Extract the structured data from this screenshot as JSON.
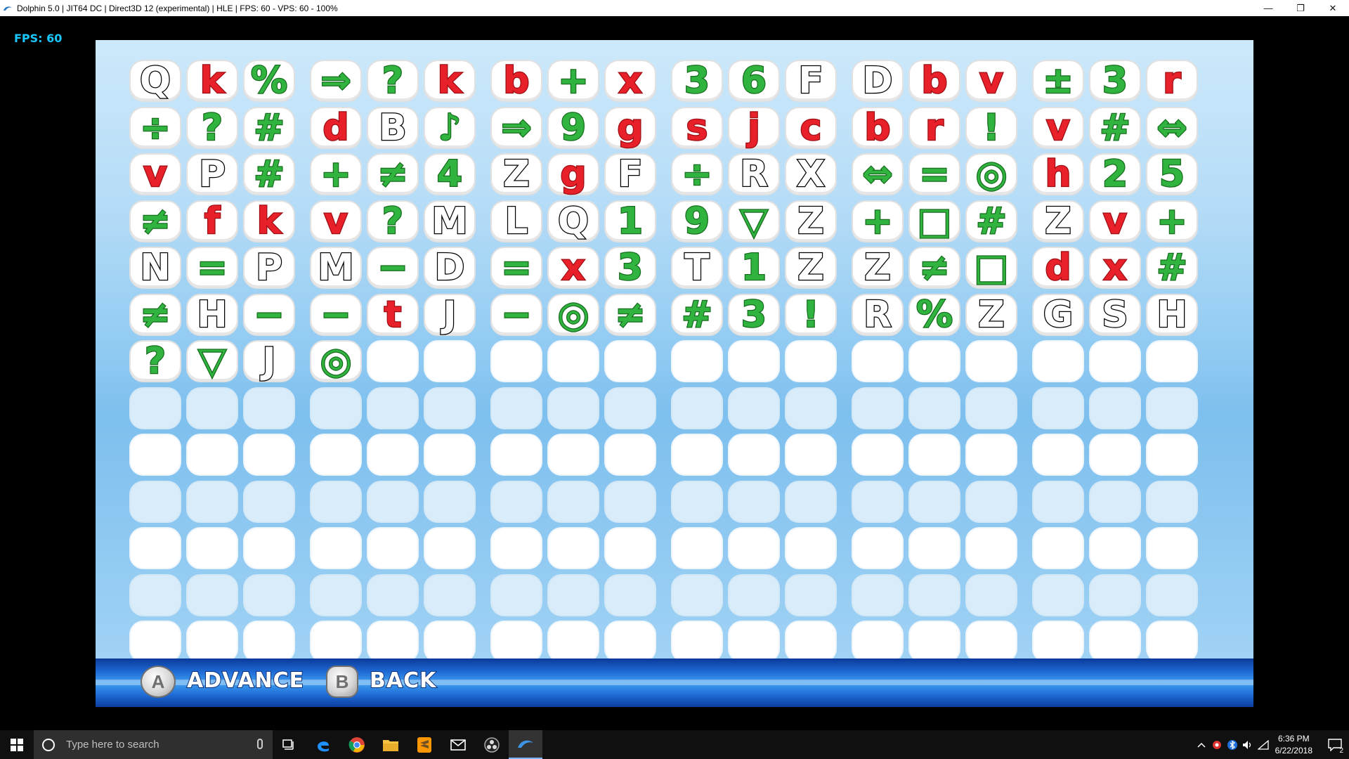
{
  "window": {
    "title": "Dolphin 5.0 | JIT64 DC | Direct3D 12 (experimental) | HLE | FPS: 60 - VPS: 60 - 100%",
    "app_icon": "dolphin-icon",
    "controls": {
      "minimize": "—",
      "restore": "❐",
      "close": "✕"
    }
  },
  "overlay": {
    "fps": "FPS: 60"
  },
  "game": {
    "colors": {
      "black": "#000000",
      "red": "#e8202a",
      "green": "#31b43f"
    },
    "grid_rows": [
      [
        [
          "Q",
          "k"
        ],
        [
          "k",
          "r"
        ],
        [
          "%",
          "g"
        ],
        [
          "⇒",
          "g"
        ],
        [
          "?",
          "g"
        ],
        [
          "k",
          "r"
        ],
        [
          "b",
          "r"
        ],
        [
          "+",
          "g"
        ],
        [
          "x",
          "r"
        ],
        [
          "3",
          "g"
        ],
        [
          "6",
          "g"
        ],
        [
          "F",
          "k"
        ],
        [
          "D",
          "k"
        ],
        [
          "b",
          "r"
        ],
        [
          "v",
          "r"
        ],
        [
          "±",
          "g"
        ],
        [
          "3",
          "g"
        ],
        [
          "r",
          "r"
        ]
      ],
      [
        [
          "÷",
          "g"
        ],
        [
          "?",
          "g"
        ],
        [
          "#",
          "g"
        ],
        [
          "d",
          "r"
        ],
        [
          "B",
          "k"
        ],
        [
          "♪",
          "g"
        ],
        [
          "⇒",
          "g"
        ],
        [
          "9",
          "g"
        ],
        [
          "g",
          "r"
        ],
        [
          "s",
          "r"
        ],
        [
          "j",
          "r"
        ],
        [
          "c",
          "r"
        ],
        [
          "b",
          "r"
        ],
        [
          "r",
          "r"
        ],
        [
          "!",
          "g"
        ],
        [
          "v",
          "r"
        ],
        [
          "#",
          "g"
        ],
        [
          "⇔",
          "g"
        ]
      ],
      [
        [
          "v",
          "r"
        ],
        [
          "P",
          "k"
        ],
        [
          "#",
          "g"
        ],
        [
          "+",
          "g"
        ],
        [
          "≠",
          "g"
        ],
        [
          "4",
          "g"
        ],
        [
          "Z",
          "k"
        ],
        [
          "g",
          "r"
        ],
        [
          "F",
          "k"
        ],
        [
          "÷",
          "g"
        ],
        [
          "R",
          "k"
        ],
        [
          "X",
          "k"
        ],
        [
          "⇔",
          "g"
        ],
        [
          "=",
          "g"
        ],
        [
          "◎",
          "g"
        ],
        [
          "h",
          "r"
        ],
        [
          "2",
          "g"
        ],
        [
          "5",
          "g"
        ]
      ],
      [
        [
          "≠",
          "g"
        ],
        [
          "f",
          "r"
        ],
        [
          "k",
          "r"
        ],
        [
          "v",
          "r"
        ],
        [
          "?",
          "g"
        ],
        [
          "M",
          "k"
        ],
        [
          "L",
          "k"
        ],
        [
          "Q",
          "k"
        ],
        [
          "1",
          "g"
        ],
        [
          "9",
          "g"
        ],
        [
          "▽",
          "g"
        ],
        [
          "Z",
          "k"
        ],
        [
          "+",
          "g"
        ],
        [
          "□",
          "g"
        ],
        [
          "#",
          "g"
        ],
        [
          "Z",
          "k"
        ],
        [
          "v",
          "r"
        ],
        [
          "+",
          "g"
        ]
      ],
      [
        [
          "N",
          "k"
        ],
        [
          "=",
          "g"
        ],
        [
          "P",
          "k"
        ],
        [
          "M",
          "k"
        ],
        [
          "−",
          "g"
        ],
        [
          "D",
          "k"
        ],
        [
          "=",
          "g"
        ],
        [
          "x",
          "r"
        ],
        [
          "3",
          "g"
        ],
        [
          "T",
          "k"
        ],
        [
          "1",
          "g"
        ],
        [
          "Z",
          "k"
        ],
        [
          "Z",
          "k"
        ],
        [
          "≠",
          "g"
        ],
        [
          "□",
          "g"
        ],
        [
          "d",
          "r"
        ],
        [
          "x",
          "r"
        ],
        [
          "#",
          "g"
        ]
      ],
      [
        [
          "≠",
          "g"
        ],
        [
          "H",
          "k"
        ],
        [
          "−",
          "g"
        ],
        [
          "−",
          "g"
        ],
        [
          "t",
          "r"
        ],
        [
          "J",
          "k"
        ],
        [
          "−",
          "g"
        ],
        [
          "◎",
          "g"
        ],
        [
          "≠",
          "g"
        ],
        [
          "#",
          "g"
        ],
        [
          "3",
          "g"
        ],
        [
          "!",
          "g"
        ],
        [
          "R",
          "k"
        ],
        [
          "%",
          "g"
        ],
        [
          "Z",
          "k"
        ],
        [
          "G",
          "k"
        ],
        [
          "S",
          "k"
        ],
        [
          "H",
          "k"
        ]
      ],
      [
        [
          "?",
          "g"
        ],
        [
          "▽",
          "g"
        ],
        [
          "J",
          "k"
        ],
        [
          "◎",
          "g"
        ]
      ]
    ],
    "total_rows": 13,
    "columns": 18
  },
  "bottom_bar": {
    "a_button": "A",
    "advance_label": "ADVANCE",
    "b_button": "B",
    "back_label": "BACK"
  },
  "taskbar": {
    "search_placeholder": "Type here to search",
    "clock_time": "6:36 PM",
    "clock_date": "6/22/2018",
    "notification_count": "2"
  }
}
